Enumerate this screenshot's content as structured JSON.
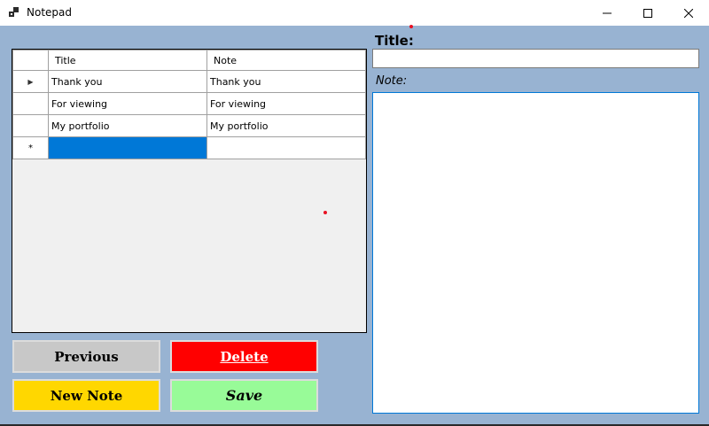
{
  "window": {
    "title": "Notepad",
    "minimize_glyph": "—",
    "maximize_glyph": "☐",
    "close_glyph": "✕"
  },
  "grid": {
    "columns": [
      "Title",
      "Note"
    ],
    "rows": [
      {
        "title": "Thank you",
        "note": "Thank you",
        "indicator": "▶"
      },
      {
        "title": "For viewing",
        "note": "For viewing",
        "indicator": ""
      },
      {
        "title": "My portfolio",
        "note": "My portfolio",
        "indicator": ""
      }
    ],
    "new_row_indicator": "*",
    "new_row_title": "",
    "new_row_note": ""
  },
  "form": {
    "title_label": "Title:",
    "title_value": "",
    "note_label": "Note:",
    "note_value": ""
  },
  "buttons": {
    "previous": "Previous",
    "delete": "Delete",
    "new_note": "New Note",
    "save": "Save"
  },
  "colors": {
    "background": "#98b3d2",
    "selection": "#0078d7",
    "delete": "#ff0000",
    "new_note": "#ffd700",
    "save": "#98fb98",
    "previous": "#c8c8c8"
  }
}
